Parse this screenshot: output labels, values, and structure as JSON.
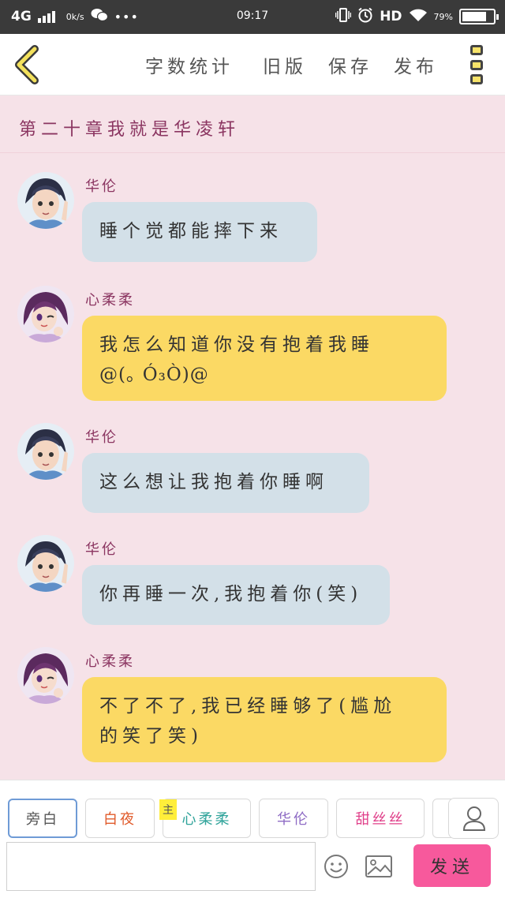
{
  "status_bar": {
    "network": "4G",
    "speed": "0k/s",
    "time": "09:17",
    "hd": "HD",
    "battery": "79%",
    "battery_level": 0.79
  },
  "toolbar": {
    "word_count": "字数统计",
    "old_version": "旧版",
    "save": "保存",
    "publish": "发布"
  },
  "chapter": {
    "title": "第二十章我就是华凌轩"
  },
  "messages": [
    {
      "speaker": "华伦",
      "text": "睡个觉都能摔下来"
    },
    {
      "speaker": "心柔柔",
      "text_line1": "我怎么知道你没有抱着我睡",
      "text_line2": "@(｡ Ó₃Ò)@"
    },
    {
      "speaker": "华伦",
      "text": "这么想让我抱着你睡啊"
    },
    {
      "speaker": "华伦",
      "text": "你再睡一次,我抱着你(笑)"
    },
    {
      "speaker": "心柔柔",
      "text_line1": "不了不了,我已经睡够了(尴尬",
      "text_line2": "的笑了笑)"
    }
  ],
  "roles": [
    {
      "label": "旁白",
      "color": "#555555"
    },
    {
      "label": "白夜",
      "color": "#e05a2a"
    },
    {
      "label": "心柔柔",
      "color": "#2fa39a"
    },
    {
      "label": "华伦",
      "color": "#8e6bc4"
    },
    {
      "label": "甜丝丝",
      "color": "#e0408a"
    }
  ],
  "main_badge": "主",
  "send_label": "发送",
  "colors": {
    "background": "#f6e2e8",
    "bubble_blue": "#d3e0e8",
    "bubble_yellow": "#fbd964",
    "send_button": "#f7599c",
    "name_color": "#8b3561"
  }
}
